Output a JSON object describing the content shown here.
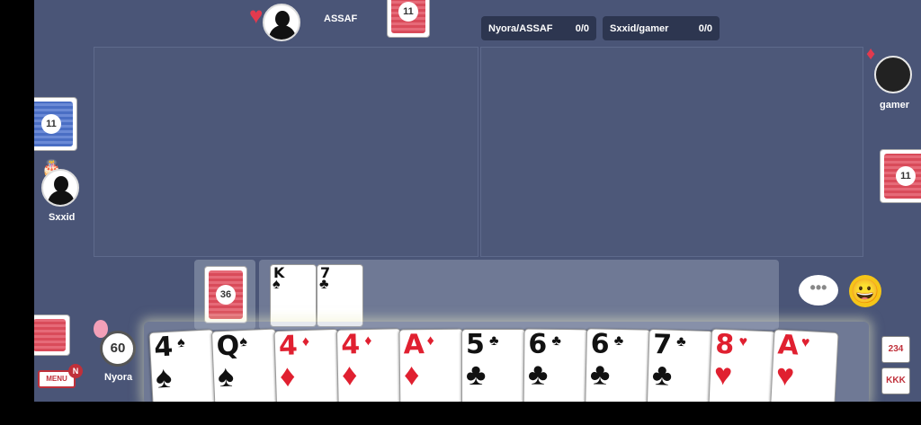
{
  "players": {
    "top": {
      "name": "ASSAF",
      "deck_count": "11"
    },
    "left": {
      "name": "Sxxid",
      "deck_count": "11"
    },
    "right": {
      "name": "gamer",
      "deck_count": "11"
    },
    "self": {
      "name": "Nyora",
      "timer": "60"
    }
  },
  "scores": [
    {
      "team": "Nyora/ASSAF",
      "score": "0/0"
    },
    {
      "team": "Sxxid/gamer",
      "score": "0/0"
    }
  ],
  "stock": {
    "count": "36"
  },
  "discard": [
    {
      "rank": "K",
      "suit": "♠",
      "color": "black"
    },
    {
      "rank": "7",
      "suit": "♣",
      "color": "black"
    }
  ],
  "hand": [
    {
      "rank": "4",
      "suit": "♠",
      "color": "black"
    },
    {
      "rank": "Q",
      "suit": "♠",
      "color": "black"
    },
    {
      "rank": "4",
      "suit": "♦",
      "color": "red"
    },
    {
      "rank": "4",
      "suit": "♦",
      "color": "red"
    },
    {
      "rank": "A",
      "suit": "♦",
      "color": "red"
    },
    {
      "rank": "5",
      "suit": "♣",
      "color": "black"
    },
    {
      "rank": "6",
      "suit": "♣",
      "color": "black"
    },
    {
      "rank": "6",
      "suit": "♣",
      "color": "black"
    },
    {
      "rank": "7",
      "suit": "♣",
      "color": "black"
    },
    {
      "rank": "8",
      "suit": "♥",
      "color": "red"
    },
    {
      "rank": "A",
      "suit": "♥",
      "color": "red"
    }
  ],
  "controls": {
    "menu_label": "MENU",
    "menu_badge": "N",
    "chat_icon": "speech-bubble-icon",
    "chat_glyph": "•••",
    "emoji_icon": "smiley-icon",
    "emoji_glyph": "😀",
    "sort_run_label": "234",
    "sort_set_label": "KKK"
  },
  "colors": {
    "table": "#4a5577",
    "card_back_red": "#d94b5a",
    "card_back_blue": "#4a6ec4",
    "score_box": "#2d3650"
  }
}
